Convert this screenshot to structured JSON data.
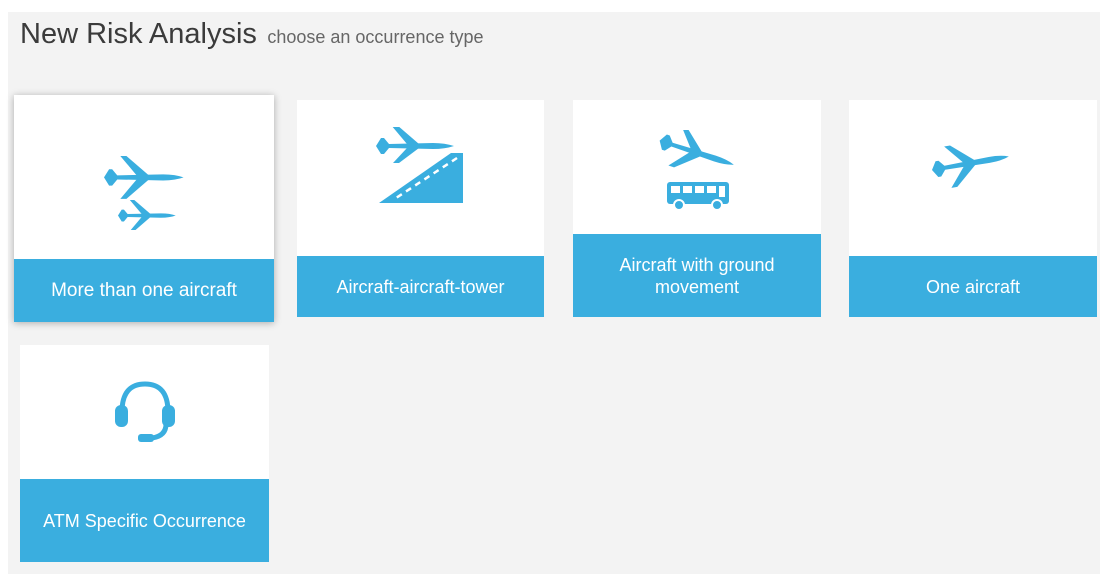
{
  "header": {
    "title": "New Risk Analysis",
    "subtitle": "choose an occurrence type"
  },
  "occurrence_types": [
    {
      "label": "More than one aircraft",
      "icon": "two-aircraft-icon",
      "selected": true
    },
    {
      "label": "Aircraft-aircraft-tower",
      "icon": "aircraft-runway-icon",
      "selected": false
    },
    {
      "label": "Aircraft with ground movement",
      "icon": "aircraft-bus-icon",
      "selected": false
    },
    {
      "label": "One aircraft",
      "icon": "aircraft-icon",
      "selected": false
    },
    {
      "label": "ATM Specific Occurrence",
      "icon": "headset-icon",
      "selected": false
    }
  ],
  "colors": {
    "accent": "#3aaedf",
    "icon": "#3aaedf",
    "background": "#f3f3f3",
    "card": "#ffffff",
    "title": "#3b3b3b"
  }
}
